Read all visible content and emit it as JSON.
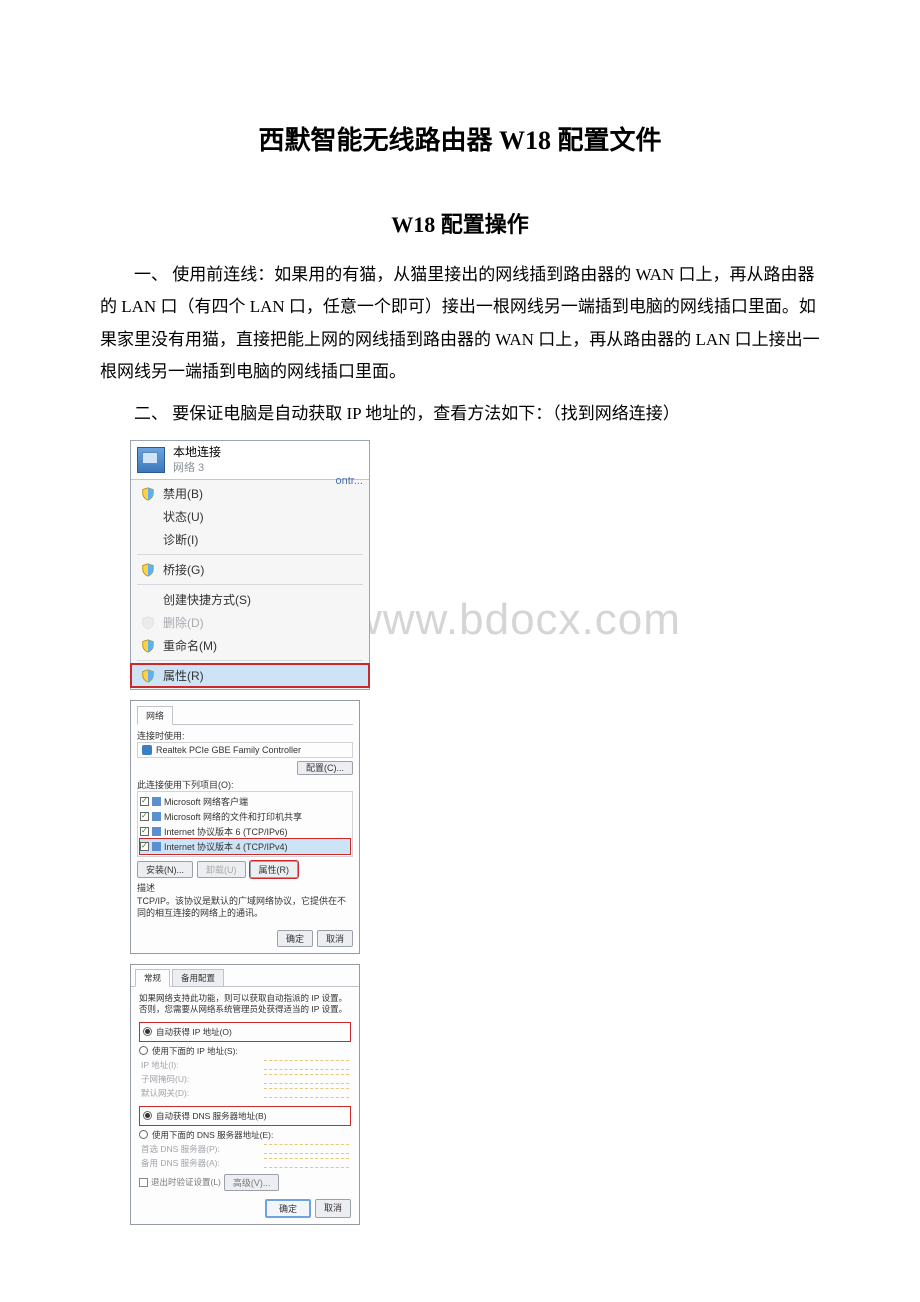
{
  "title": "西默智能无线路由器 W18 配置文件",
  "subtitle": "W18 配置操作",
  "para1": "一、 使用前连线：如果用的有猫，从猫里接出的网线插到路由器的 WAN 口上，再从路由器的 LAN 口（有四个 LAN 口，任意一个即可）接出一根网线另一端插到电脑的网线插口里面。如果家里没有用猫，直接把能上网的网线插到路由器的 WAN 口上，再从路由器的 LAN 口上接出一根网线另一端插到电脑的网线插口里面。",
  "para2": "二、 要保证电脑是自动获取 IP 地址的，查看方法如下：（找到网络连接）",
  "watermark": "www.bdocx.com",
  "fig1": {
    "header_line1": "本地连接",
    "header_line2": "网络 3",
    "ontr": "ontr...",
    "items": {
      "disable": "禁用(B)",
      "status": "状态(U)",
      "diagnose": "诊断(I)",
      "bridge": "桥接(G)",
      "shortcut": "创建快捷方式(S)",
      "delete": "删除(D)",
      "rename": "重命名(M)",
      "properties": "属性(R)"
    }
  },
  "fig2": {
    "tab": "网络",
    "connect_label": "连接时使用:",
    "adapter": "Realtek PCIe GBE Family Controller",
    "configure": "配置(C)...",
    "items_label": "此连接使用下列项目(O):",
    "items": {
      "client": "Microsoft 网络客户端",
      "fileshare": "Microsoft 网络的文件和打印机共享",
      "ipv6": "Internet 协议版本 6 (TCP/IPv6)",
      "ipv4": "Internet 协议版本 4 (TCP/IPv4)"
    },
    "install": "安装(N)...",
    "uninstall": "卸载(U)",
    "properties": "属性(R)",
    "desc_label": "描述",
    "desc": "TCP/IP。该协议是默认的广域网络协议，它提供在不同的相互连接的网络上的通讯。",
    "ok": "确定",
    "cancel": "取消"
  },
  "fig3": {
    "tab_general": "常规",
    "tab_alt": "备用配置",
    "note": "如果网络支持此功能，则可以获取自动指派的 IP 设置。否则，您需要从网络系统管理员处获得适当的 IP 设置。",
    "auto_ip": "自动获得 IP 地址(O)",
    "manual_ip": "使用下面的 IP 地址(S):",
    "ip_label": "IP 地址(I):",
    "mask_label": "子网掩码(U):",
    "gw_label": "默认网关(D):",
    "auto_dns": "自动获得 DNS 服务器地址(B)",
    "manual_dns": "使用下面的 DNS 服务器地址(E):",
    "dns1_label": "首选 DNS 服务器(P):",
    "dns2_label": "备用 DNS 服务器(A):",
    "exit_validate": "退出时验证设置(L)",
    "advanced": "高级(V)...",
    "ok": "确定",
    "cancel": "取消"
  }
}
